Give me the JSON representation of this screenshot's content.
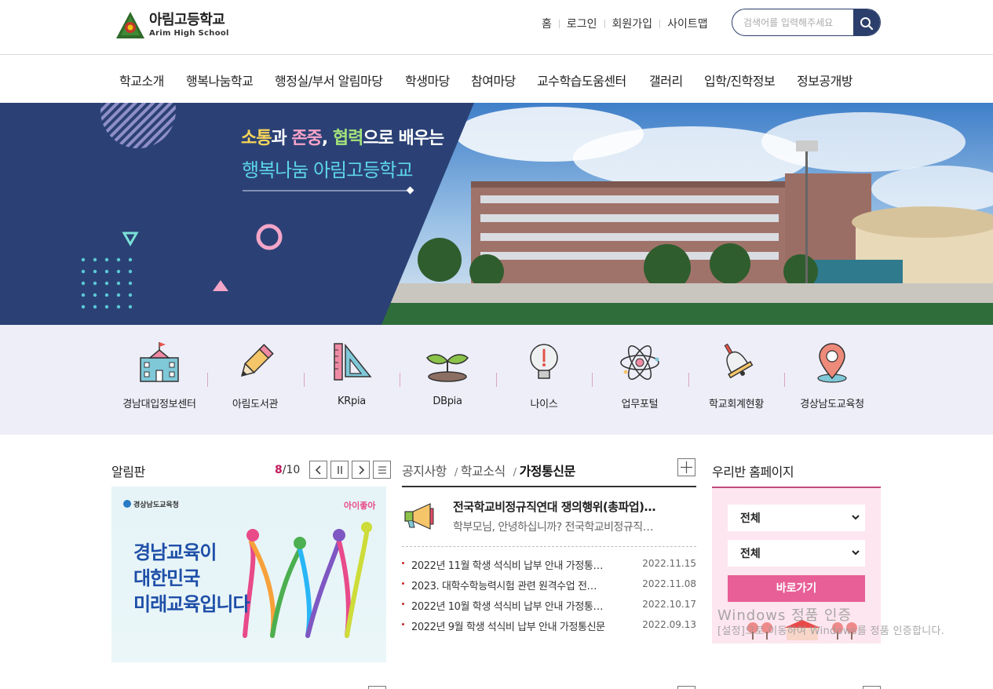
{
  "header": {
    "logo_ko": "아림고등학교",
    "logo_en": "Arim High School",
    "util_links": [
      "홈",
      "로그인",
      "회원가입",
      "사이트맵"
    ],
    "search_placeholder": "검색어를 입력해주세요"
  },
  "gnb": [
    "학교소개",
    "행복나눔학교",
    "행정실/부서 알림마당",
    "학생마당",
    "참여마당",
    "교수학습도움센터",
    "갤러리",
    "입학/진학정보",
    "정보공개방"
  ],
  "hero": {
    "line1_parts": [
      "소통",
      "과 ",
      "존중",
      ", ",
      "협력",
      "으로 배우는"
    ],
    "line2": "행복나눔 아림고등학교"
  },
  "quick_links": [
    {
      "label": "경남대입정보센터",
      "icon": "school-building-icon"
    },
    {
      "label": "아림도서관",
      "icon": "pencil-icon"
    },
    {
      "label": "KRpia",
      "icon": "ruler-triangle-icon"
    },
    {
      "label": "DBpia",
      "icon": "sprout-icon"
    },
    {
      "label": "나이스",
      "icon": "lightbulb-icon"
    },
    {
      "label": "업무포털",
      "icon": "atom-icon"
    },
    {
      "label": "학교회계현황",
      "icon": "bell-icon"
    },
    {
      "label": "경상남도교육청",
      "icon": "map-pin-icon"
    }
  ],
  "notice_board": {
    "title": "알림판",
    "current_page": "8",
    "total_pages": "/10",
    "banner_org": "경상남도교육청",
    "banner_brand": "아이좋아",
    "banner_lines": [
      "경남교육이",
      "대한민국",
      "미래교육입니다"
    ]
  },
  "news": {
    "tabs": [
      "공지사항",
      "학교소식",
      "가정통신문"
    ],
    "active_tab": "가정통신문",
    "featured_title": "전국학교비정규직연대 쟁의행위(총파업)…",
    "featured_desc": "학부모님, 안녕하십니까? 전국학교비정규직…",
    "items": [
      {
        "title": "2022년 11월 학생 석식비 납부 안내 가정통…",
        "date": "2022.11.15"
      },
      {
        "title": "2023. 대학수학능력시험 관련 원격수업 전…",
        "date": "2022.11.08"
      },
      {
        "title": "2022년 10월 학생 석식비 납부 안내 가정통…",
        "date": "2022.10.17"
      },
      {
        "title": "2022년 9월 학생 석식비 납부 안내 가정통신문",
        "date": "2022.09.13"
      }
    ]
  },
  "class_homepage": {
    "title": "우리반 홈페이지",
    "select1": "전체",
    "select2": "전체",
    "go_label": "바로가기"
  },
  "watermark": {
    "line1": "Windows 정품 인증",
    "line2": "[설정]으로 이동하여 Windows를 정품 인증합니다."
  },
  "colors": {
    "navy": "#2c3e6b",
    "pink": "#e85f97",
    "lavender_band": "#eeeef9"
  }
}
